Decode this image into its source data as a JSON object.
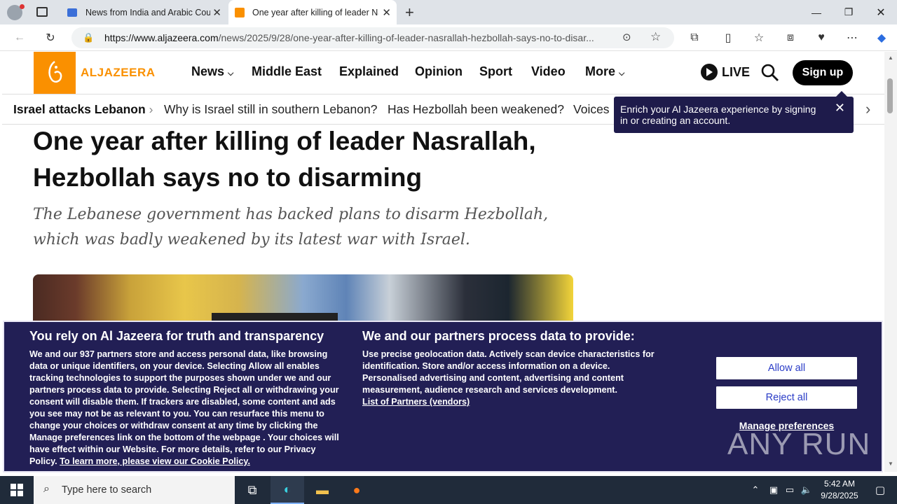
{
  "browser": {
    "tabs": [
      {
        "title": "News from India and Arabic Coun",
        "active": false
      },
      {
        "title": "One year after killing of leader Na",
        "active": true
      }
    ],
    "url_domain": "https://www.aljazeera.com",
    "url_path": "/news/2025/9/28/one-year-after-killing-of-leader-nasrallah-hezbollah-says-no-to-disar..."
  },
  "site": {
    "logo_text": "ALJAZEERA",
    "menu": [
      "News",
      "Middle East",
      "Explained",
      "Opinion",
      "Sport",
      "Video",
      "More"
    ],
    "live_label": "LIVE",
    "signup_label": "Sign up"
  },
  "ticker": {
    "label": "Israel attacks Lebanon",
    "items": [
      "Why is Israel still in southern Lebanon?",
      "Has Hezbollah been weakened?",
      "Voices"
    ]
  },
  "tooltip": {
    "text": "Enrich your Al Jazeera experience by signing in or creating an account."
  },
  "article": {
    "headline": "One year after killing of leader Nasrallah, Hezbollah says no to disarming",
    "subhead": "The Lebanese government has backed plans to disarm Hezbollah, which was badly weakened by its latest war with Israel."
  },
  "cookie": {
    "title1": "You rely on Al Jazeera for truth and transparency",
    "body1_a": "We and our ",
    "body1_count": "937",
    "body1_b": " partners store and access personal data, like browsing data or unique identifiers, on your device. Selecting Allow all enables tracking technologies to support the purposes shown under we and our partners process data to provide. Selecting Reject all or withdrawing your consent will disable them. If trackers are disabled, some content and ads you see may not be as relevant to you. You can resurface this menu to change your choices or withdraw consent at any time by clicking the Manage preferences link on the bottom of the webpage . Your choices will have effect within our Website. For more details, refer to our Privacy Policy. ",
    "body1_link": "To learn more, please view our Cookie Policy.",
    "title2": "We and our partners process data to provide:",
    "body2": "Use precise geolocation data. Actively scan device characteristics for identification. Store and/or access information on a device. Personalised advertising and content, advertising and content measurement, audience research and services development.",
    "body2_link": "List of Partners (vendors)",
    "allow_label": "Allow all",
    "reject_label": "Reject all",
    "manage_label": "Manage preferences",
    "watermark": "ANY RUN"
  },
  "taskbar": {
    "search_placeholder": "Type here to search",
    "time": "5:42 AM",
    "date": "9/28/2025"
  }
}
